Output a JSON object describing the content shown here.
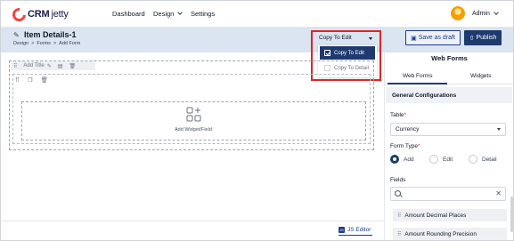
{
  "app": {
    "logo_text": "CRM",
    "logo_text_2": "jetty"
  },
  "nav": {
    "links": [
      {
        "label": "Dashboard"
      },
      {
        "label": "Design"
      },
      {
        "label": "Settings"
      }
    ],
    "user": "Admin"
  },
  "header": {
    "title": "Item Details-1",
    "breadcrumb": [
      "Design",
      ">",
      "Forms",
      ">",
      "Add Form"
    ],
    "copy_select": "Copy To Edit",
    "save_draft": "Save as draft",
    "publish": "Publish"
  },
  "dropdown": {
    "options": [
      {
        "label": "Copy To Edit",
        "selected": true
      },
      {
        "label": "Copy To Detail",
        "selected": false
      }
    ]
  },
  "canvas": {
    "add_title": "Add Title",
    "add_widget": "Add Widget/Field"
  },
  "footer": {
    "js_editor": "JS Editor"
  },
  "panel": {
    "title": "Web Forms",
    "tabs": [
      "Web Forms",
      "Widgets"
    ],
    "section": "General Configurations",
    "table_label": "Table",
    "table_value": "Currency",
    "form_type_label": "Form Type",
    "form_types": [
      {
        "label": "Add",
        "selected": true
      },
      {
        "label": "Edit",
        "selected": false
      },
      {
        "label": "Detail",
        "selected": false
      }
    ],
    "fields_label": "Fields",
    "fields": [
      "Amount Decimal Places",
      "Amount Rounding Precision"
    ]
  },
  "colors": {
    "accent": "#1e3a6e",
    "highlight": "#dc2626",
    "subheader": "#dbe4f1"
  }
}
